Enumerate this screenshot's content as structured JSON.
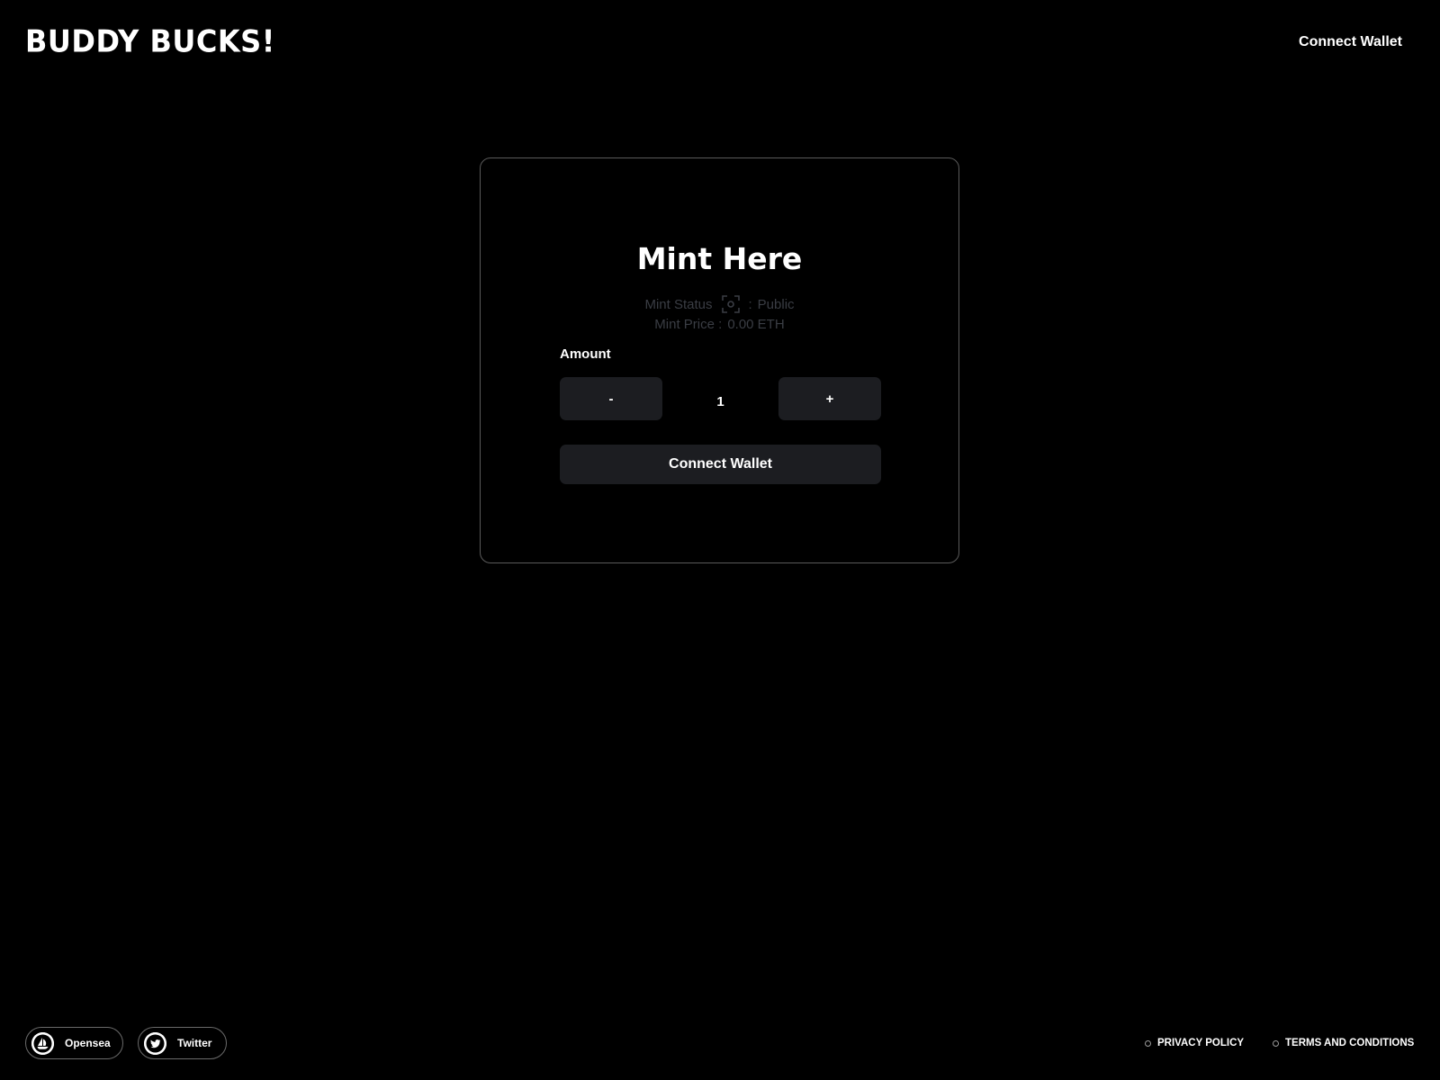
{
  "header": {
    "logo": "BUDDY BUCKS!",
    "connect_wallet": "Connect Wallet"
  },
  "mint_card": {
    "title": "Mint Here",
    "status_label": "Mint Status",
    "status_icon": "scan-icon",
    "status_separator": ":",
    "status_value": "Public",
    "price_label": "Mint Price :",
    "price_value": "0.00 ETH",
    "amount_label": "Amount",
    "minus_label": "-",
    "amount_value": "1",
    "plus_label": "+",
    "connect_button_label": "Connect Wallet"
  },
  "footer": {
    "social": [
      {
        "label": "Opensea",
        "icon": "opensea-icon"
      },
      {
        "label": "Twitter",
        "icon": "twitter-icon"
      }
    ],
    "legal": [
      {
        "label": "PRIVACY POLICY"
      },
      {
        "label": "TERMS AND CONDITIONS"
      }
    ]
  },
  "colors": {
    "background": "#000000",
    "text": "#ffffff",
    "muted_text": "#3a3d44",
    "button_bg": "#1c1d21",
    "card_border": "#5a5a5a"
  }
}
